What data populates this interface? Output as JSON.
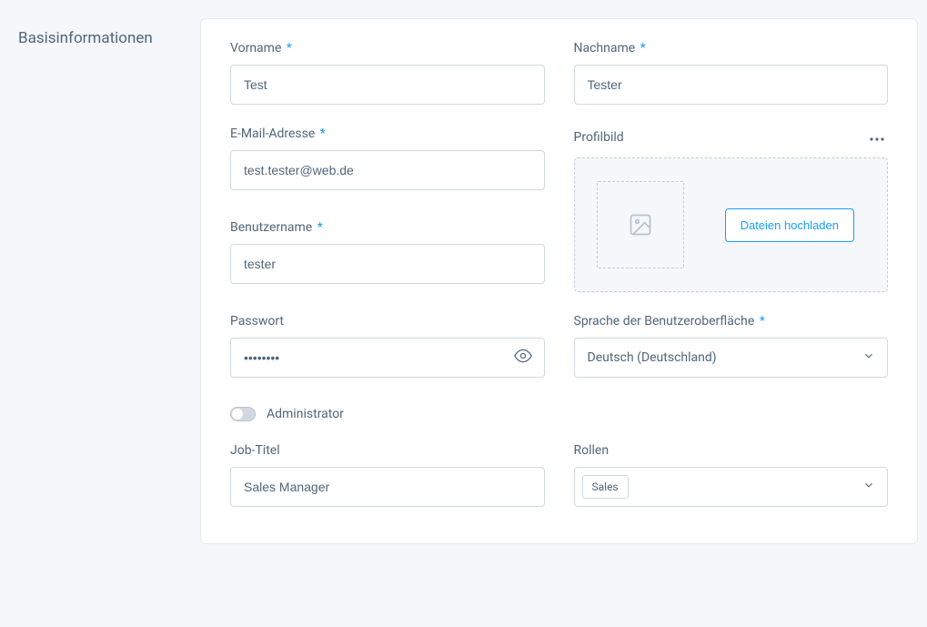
{
  "section_title": "Basisinformationen",
  "required_mark": "*",
  "fields": {
    "firstname": {
      "label": "Vorname",
      "value": "Test",
      "required": true
    },
    "lastname": {
      "label": "Nachname",
      "value": "Tester",
      "required": true
    },
    "email": {
      "label": "E-Mail-Adresse",
      "value": "test.tester@web.de",
      "required": true
    },
    "username": {
      "label": "Benutzername",
      "value": "tester",
      "required": true
    },
    "password": {
      "label": "Passwort",
      "value": "••••••••"
    },
    "profile_image": {
      "label": "Profilbild",
      "upload_button": "Dateien hochladen"
    },
    "language": {
      "label": "Sprache der Benutzeroberfläche",
      "value": "Deutsch (Deutschland)",
      "required": true
    },
    "admin": {
      "label": "Administrator"
    },
    "job_title": {
      "label": "Job-Titel",
      "value": "Sales Manager"
    },
    "roles": {
      "label": "Rollen",
      "tags": [
        "Sales"
      ]
    }
  }
}
